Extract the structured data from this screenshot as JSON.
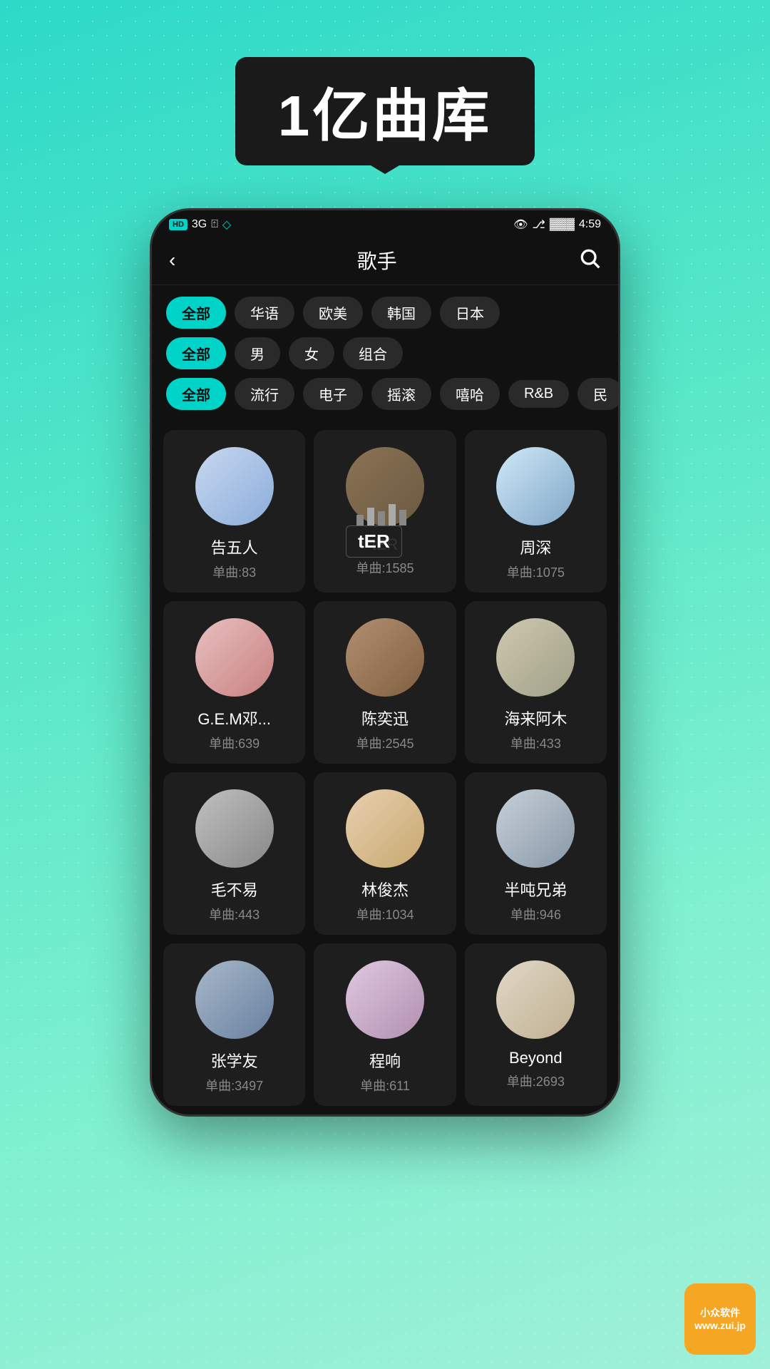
{
  "page": {
    "title": "1亿曲库",
    "background_color": "#40d8c8"
  },
  "status_bar": {
    "badge": "HD",
    "signal": "3G",
    "time": "4:59",
    "battery": "▓▓▓"
  },
  "nav": {
    "title": "歌手",
    "back_icon": "‹",
    "search_icon": "search"
  },
  "filters": {
    "row1": {
      "items": [
        {
          "label": "全部",
          "active": true
        },
        {
          "label": "华语",
          "active": false
        },
        {
          "label": "欧美",
          "active": false
        },
        {
          "label": "韩国",
          "active": false
        },
        {
          "label": "日本",
          "active": false
        }
      ]
    },
    "row2": {
      "items": [
        {
          "label": "全部",
          "active": true
        },
        {
          "label": "男",
          "active": false
        },
        {
          "label": "女",
          "active": false
        },
        {
          "label": "组合",
          "active": false
        }
      ]
    },
    "row3": {
      "items": [
        {
          "label": "全部",
          "active": true
        },
        {
          "label": "流行",
          "active": false
        },
        {
          "label": "电子",
          "active": false
        },
        {
          "label": "摇滚",
          "active": false
        },
        {
          "label": "嘻哈",
          "active": false
        },
        {
          "label": "R&B",
          "active": false
        },
        {
          "label": "民",
          "active": false
        }
      ]
    }
  },
  "artists": [
    {
      "name": "告五人",
      "count": "单曲:83",
      "avatar_class": "avatar-gaowuren",
      "avatar_emoji": "🎵"
    },
    {
      "name": "tER",
      "count": "单曲:1585",
      "avatar_class": "avatar-ter",
      "avatar_emoji": "🎤",
      "is_ter": true
    },
    {
      "name": "周深",
      "count": "单曲:1075",
      "avatar_class": "avatar-zhoushen",
      "avatar_emoji": "👤"
    },
    {
      "name": "G.E.M邓...",
      "count": "单曲:639",
      "avatar_class": "avatar-gem",
      "avatar_emoji": "👤"
    },
    {
      "name": "陈奕迅",
      "count": "单曲:2545",
      "avatar_class": "avatar-chenyi",
      "avatar_emoji": "👤"
    },
    {
      "name": "海来阿木",
      "count": "单曲:433",
      "avatar_class": "avatar-hailai",
      "avatar_emoji": "👤"
    },
    {
      "name": "毛不易",
      "count": "单曲:443",
      "avatar_class": "avatar-maobuyi",
      "avatar_emoji": "👤"
    },
    {
      "name": "林俊杰",
      "count": "单曲:1034",
      "avatar_class": "avatar-linjunjie",
      "avatar_emoji": "👤"
    },
    {
      "name": "半吨兄弟",
      "count": "单曲:946",
      "avatar_class": "avatar-bantun",
      "avatar_emoji": "👥"
    },
    {
      "name": "张学友",
      "count": "单曲:3497",
      "avatar_class": "avatar-zhangxy",
      "avatar_emoji": "👤"
    },
    {
      "name": "程响",
      "count": "单曲:611",
      "avatar_class": "avatar-chengxiang",
      "avatar_emoji": "👤"
    },
    {
      "name": "Beyond",
      "count": "单曲:2693",
      "avatar_class": "avatar-beyond",
      "avatar_emoji": "👥"
    }
  ],
  "watermark": {
    "line1": "小众软件",
    "line2": "www.zui.jp"
  }
}
